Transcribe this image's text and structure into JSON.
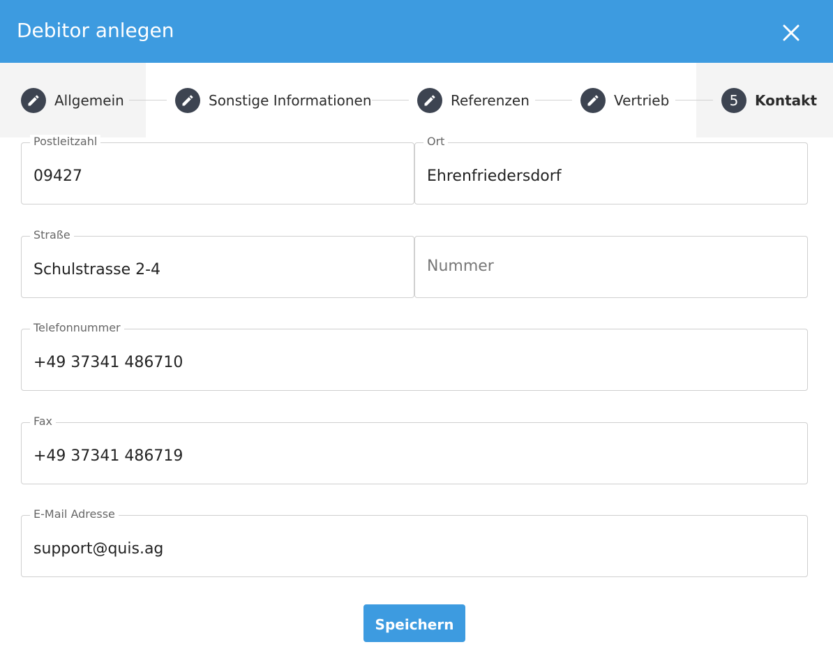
{
  "dialog": {
    "title": "Debitor anlegen"
  },
  "stepper": {
    "steps": [
      {
        "label": "Allgemein",
        "state": "edit"
      },
      {
        "label": "Sonstige Informationen",
        "state": "edit"
      },
      {
        "label": "Referenzen",
        "state": "edit"
      },
      {
        "label": "Vertrieb",
        "state": "edit"
      },
      {
        "label": "Kontakt",
        "state": "active",
        "number": "5"
      }
    ]
  },
  "form": {
    "postleitzahl": {
      "label": "Postleitzahl",
      "value": "09427"
    },
    "ort": {
      "label": "Ort",
      "value": "Ehrenfriedersdorf"
    },
    "strasse": {
      "label": "Straße",
      "value": "Schulstrasse 2-4"
    },
    "nummer": {
      "placeholder": "Nummer"
    },
    "telefon": {
      "label": "Telefonnummer",
      "value": "+49 37341 486710"
    },
    "fax": {
      "label": "Fax",
      "value": "+49 37341 486719"
    },
    "email": {
      "label": "E-Mail Adresse",
      "value": "support@quis.ag"
    }
  },
  "actions": {
    "save_label": "Speichern"
  },
  "colors": {
    "primary": "#3d9be0",
    "step_circle": "#3d4451",
    "inactive_bg": "#f4f4f4"
  },
  "icons": {
    "close": "close-icon",
    "edit": "pencil-icon"
  }
}
